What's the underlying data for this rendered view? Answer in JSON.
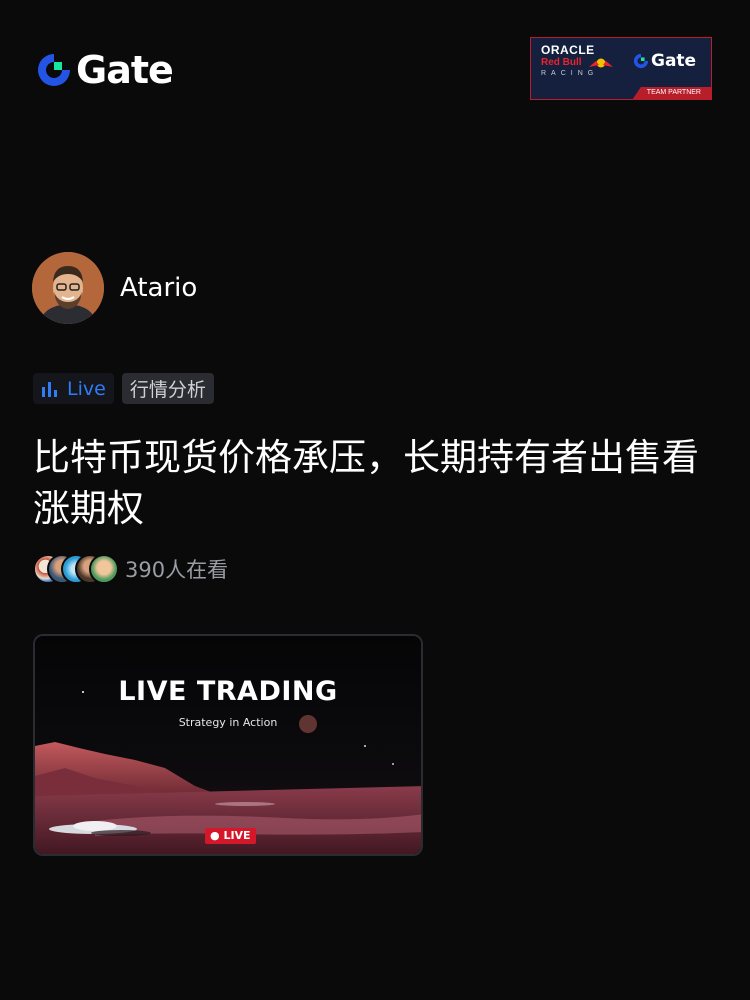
{
  "brand": {
    "name": "Gate",
    "icon": "gate-logo-icon",
    "accent": "#2354e6",
    "accent_green": "#17e6a1"
  },
  "partner_badge": {
    "line1": "ORACLE",
    "line2": "Red Bull",
    "line3": "RACING",
    "brand": "Gate",
    "footer": "TEAM PARTNER"
  },
  "author": {
    "name": "Atario",
    "avatar": "avatar-icon"
  },
  "tags": {
    "live_label": "Live",
    "live_icon": "bar-chart-icon",
    "category": "行情分析"
  },
  "post": {
    "title": "比特币现货价格承压，长期持有者出售看涨期权"
  },
  "audience": {
    "viewers_text": "390人在看"
  },
  "live_card": {
    "title": "LIVE TRADING",
    "subtitle": "Strategy in Action",
    "badge": "LIVE",
    "live_color": "#d5172a"
  }
}
